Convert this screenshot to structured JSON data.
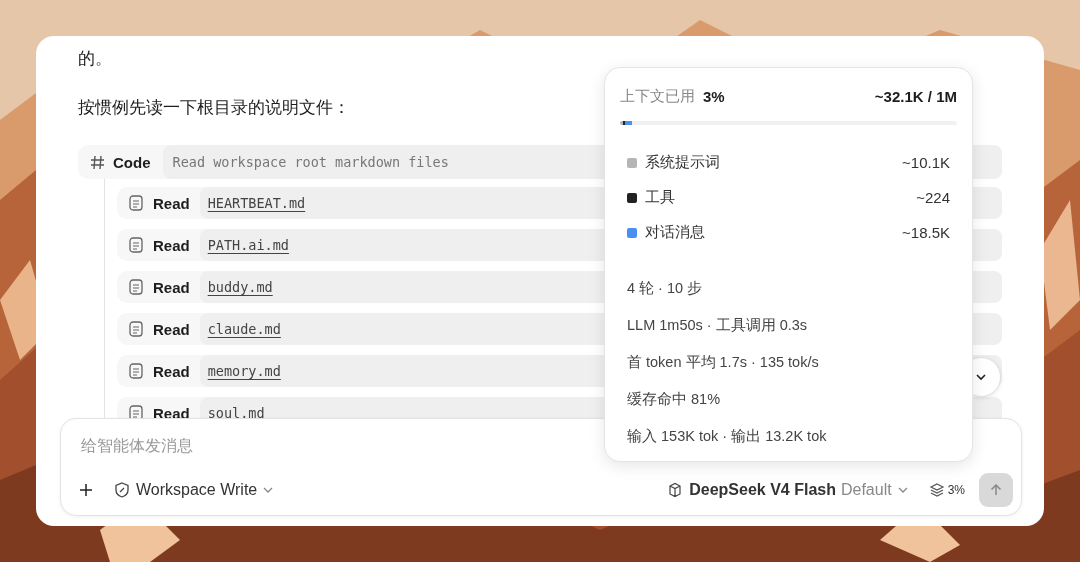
{
  "message": {
    "lines": [
      "的。",
      "按惯例先读一下根目录的说明文件："
    ]
  },
  "code_block": {
    "label": "Code",
    "description": "Read workspace root markdown files",
    "reads": [
      {
        "verb": "Read",
        "file": "HEARTBEAT.md"
      },
      {
        "verb": "Read",
        "file": "PATH.ai.md"
      },
      {
        "verb": "Read",
        "file": "buddy.md"
      },
      {
        "verb": "Read",
        "file": "claude.md"
      },
      {
        "verb": "Read",
        "file": "memory.md"
      },
      {
        "verb": "Read",
        "file": "soul.md"
      }
    ]
  },
  "context_popover": {
    "title": "上下文已用",
    "percent": "3%",
    "total": "~32.1K / 1M",
    "breakdown": [
      {
        "label": "系统提示词",
        "value": "~10.1K",
        "color": "#b5b5b5",
        "level": 0.0101
      },
      {
        "label": "工具",
        "value": "~224",
        "color": "#222222",
        "level": 0.0022
      },
      {
        "label": "对话消息",
        "value": "~18.5K",
        "color": "#4a90f0",
        "level": 0.0185
      }
    ],
    "stats": [
      "4 轮 · 10 步",
      "LLM 1m50s · 工具调用 0.3s",
      "首 token 平均 1.7s · 135 tok/s",
      "缓存命中 81%",
      "输入 153K tok · 输出 13.2K tok"
    ]
  },
  "composer": {
    "placeholder": "给智能体发消息",
    "mode": "Workspace Write",
    "model": "DeepSeek V4 Flash",
    "model_tag": "Default",
    "context_percent": "3%",
    "send_disabled": true
  }
}
